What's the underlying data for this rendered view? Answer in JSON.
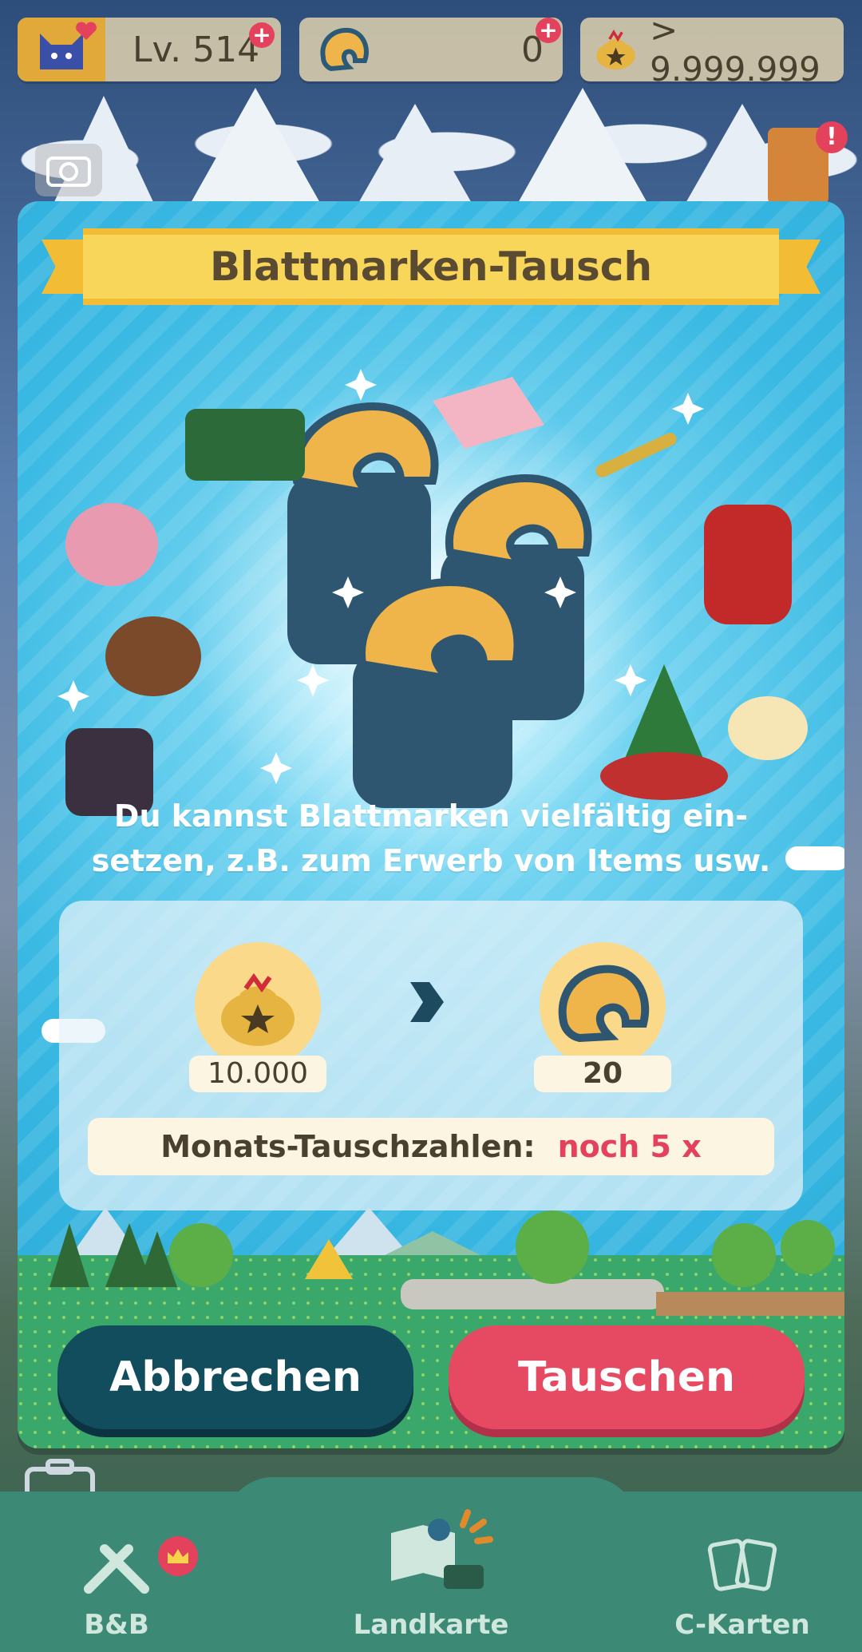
{
  "status_bar": {
    "level_label": "Lv. 514",
    "tickets_value": "0",
    "bells_value": "> 9.999.999"
  },
  "dialog": {
    "title": "Blattmarken-Tausch",
    "description_line1": "Du kannst Blattmarken vielfältig ein-",
    "description_line2": "setzen, z.B. zum Erwerb von Items usw.",
    "exchange": {
      "cost_value": "10.000",
      "reward_value": "20",
      "monthly_label": "Monats-Tauschzahlen:",
      "monthly_value": "noch 5 x"
    },
    "cancel_label": "Abbrechen",
    "confirm_label": "Tauschen"
  },
  "nav": {
    "items": [
      {
        "label": "B&B"
      },
      {
        "label": "Landkarte"
      },
      {
        "label": "C-Karten"
      }
    ]
  },
  "colors": {
    "accent_red": "#e4415d",
    "dialog_blue": "#2aa9d8",
    "banner_yellow": "#f8d65a",
    "cancel_button": "#124d5e",
    "confirm_button": "#e64a62"
  }
}
